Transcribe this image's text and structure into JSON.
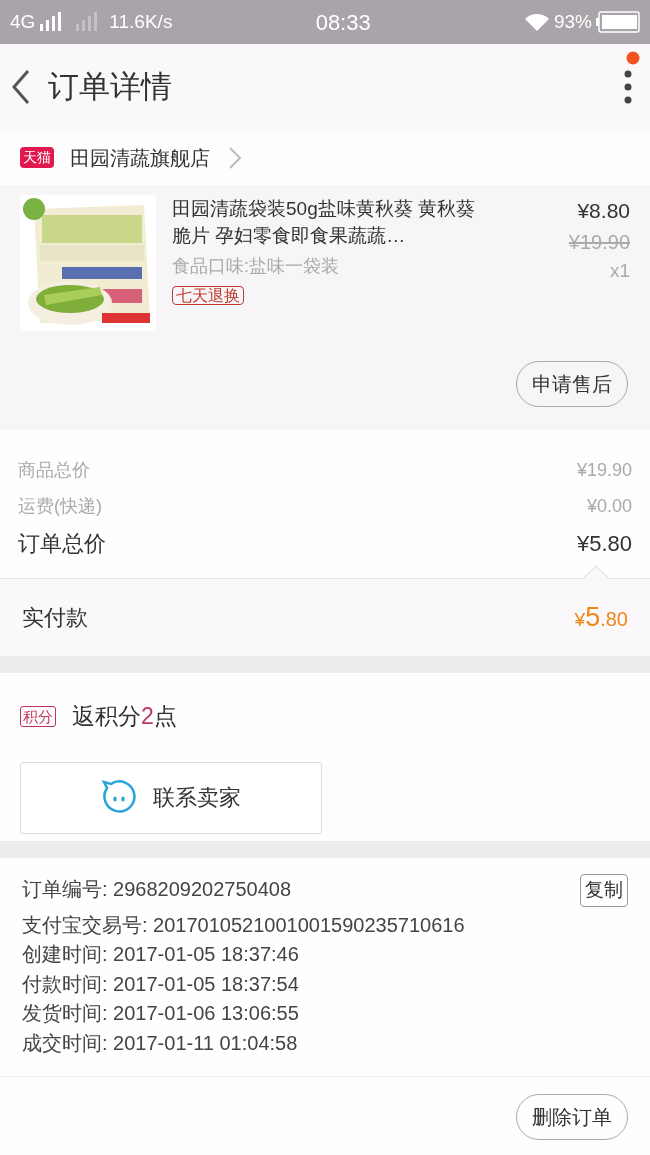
{
  "status_bar": {
    "network": "4G",
    "speed": "11.6K/s",
    "time": "08:33",
    "battery": "93%"
  },
  "header": {
    "title": "订单详情",
    "notification": true
  },
  "store": {
    "badge": "天猫",
    "name": "田园清蔬旗舰店"
  },
  "product": {
    "kind": "picture",
    "title": "田园清蔬袋装50g盐味黄秋葵 黄秋葵脆片 孕妇零食即食果蔬蔬…",
    "variant": "食品口味:盐味一袋装",
    "tag": "七天退换",
    "price": "¥8.80",
    "original_price": "¥19.90",
    "quantity": "x1",
    "action": "申请售后"
  },
  "summary": [
    {
      "label": "商品总价",
      "value": "¥19.90",
      "kind": "minor"
    },
    {
      "label": "运费(快递)",
      "value": "¥0.00",
      "kind": "minor"
    },
    {
      "label": "订单总价",
      "value": "¥5.80",
      "kind": "major"
    }
  ],
  "paid": {
    "label": "实付款",
    "currency": "¥",
    "integer": "5",
    "decimal": ".80"
  },
  "points": {
    "badge": "积分",
    "text_before": "返积分",
    "value": "2",
    "text_after": "点"
  },
  "contact_button": "联系卖家",
  "order_info": [
    {
      "label": "订单编号:",
      "value": "2968209202750408",
      "action": "复制"
    },
    {
      "label": "支付宝交易号:",
      "value": "2017010521001001590235710616"
    },
    {
      "label": "创建时间:",
      "value": "2017-01-05 18:37:46"
    },
    {
      "label": "付款时间:",
      "value": "2017-01-05 18:37:54"
    },
    {
      "label": "发货时间:",
      "value": "2017-01-06 13:06:55"
    },
    {
      "label": "成交时间:",
      "value": "2017-01-11 01:04:58"
    }
  ],
  "footer_button": "删除订单"
}
